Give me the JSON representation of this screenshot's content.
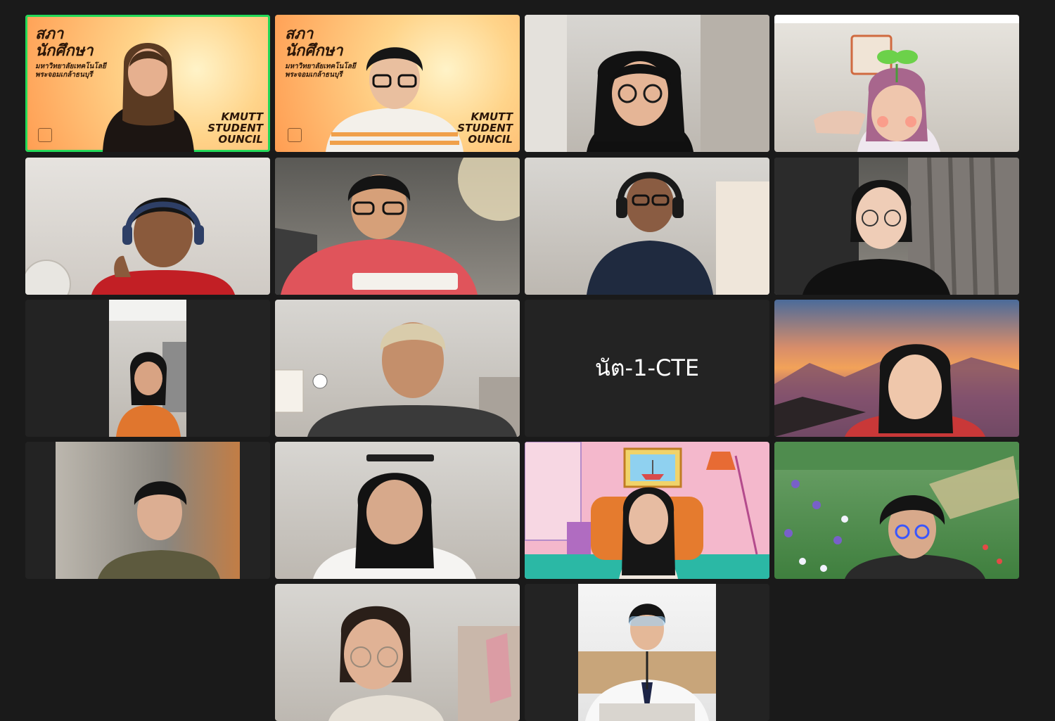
{
  "meeting": {
    "layout": "gallery-view",
    "active_speaker": "participant-1",
    "colors": {
      "background": "#1a1a1a",
      "tile": "#232323",
      "speaking_border": "#23d959"
    }
  },
  "council_background": {
    "title": "สภา\nนักศึกษา",
    "subtitle": "มหาวิทยาลัยเทคโนโลยี\nพระจอมเกล้าธนบุรี",
    "brand": "KMUTT\nSTUDENT\nOUNCIL"
  },
  "participants": [
    {
      "id": "participant-1",
      "background": "council-virtual-background"
    },
    {
      "id": "participant-2",
      "background": "council-virtual-background"
    },
    {
      "id": "participant-3",
      "background": "room"
    },
    {
      "id": "participant-4",
      "background": "room-with-sprout-filter"
    },
    {
      "id": "participant-5",
      "background": "room"
    },
    {
      "id": "participant-6",
      "background": "room"
    },
    {
      "id": "participant-7",
      "background": "room"
    },
    {
      "id": "participant-8",
      "background": "room"
    },
    {
      "id": "participant-9",
      "background": "portrait-camera"
    },
    {
      "id": "participant-10",
      "background": "room"
    },
    {
      "id": "participant-11",
      "name": "นัต-1-CTE",
      "video": "off"
    },
    {
      "id": "participant-12",
      "background": "sunset-mountains"
    },
    {
      "id": "participant-13",
      "background": "blurred"
    },
    {
      "id": "participant-14",
      "background": "room"
    },
    {
      "id": "participant-15",
      "background": "cartoon-living-room"
    },
    {
      "id": "participant-16",
      "background": "garden-painting"
    },
    {
      "id": "participant-17",
      "background": "room"
    },
    {
      "id": "participant-18",
      "background": "portrait-camera"
    }
  ]
}
